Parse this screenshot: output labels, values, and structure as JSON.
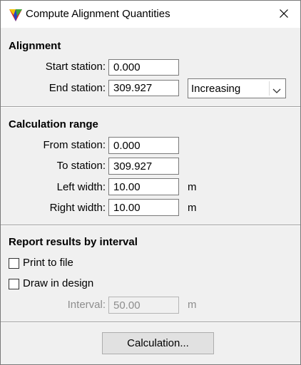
{
  "window": {
    "title": "Compute Alignment Quantities",
    "app_icon": "triangle-app-icon",
    "close_icon": "close-icon"
  },
  "alignment": {
    "heading": "Alignment",
    "start_station_label": "Start station:",
    "start_station_value": "0.000",
    "end_station_label": "End station:",
    "end_station_value": "309.927",
    "direction_value": "Increasing",
    "direction_icon": "chevron-down-icon"
  },
  "calculation_range": {
    "heading": "Calculation range",
    "from_label": "From station:",
    "from_value": "0.000",
    "to_label": "To station:",
    "to_value": "309.927",
    "left_width_label": "Left width:",
    "left_width_value": "10.00",
    "left_width_unit": "m",
    "right_width_label": "Right width:",
    "right_width_value": "10.00",
    "right_width_unit": "m"
  },
  "report": {
    "heading": "Report results by interval",
    "print_to_file_label": "Print to file",
    "print_to_file_checked": false,
    "draw_in_design_label": "Draw in design",
    "draw_in_design_checked": false,
    "interval_label": "Interval:",
    "interval_value": "50.00",
    "interval_unit": "m"
  },
  "footer": {
    "calculation_button": "Calculation..."
  },
  "colors": {
    "dialog_bg": "#f0f0f0",
    "icon_red": "#e02020",
    "icon_green": "#3aa53a",
    "icon_blue": "#2346c8"
  }
}
